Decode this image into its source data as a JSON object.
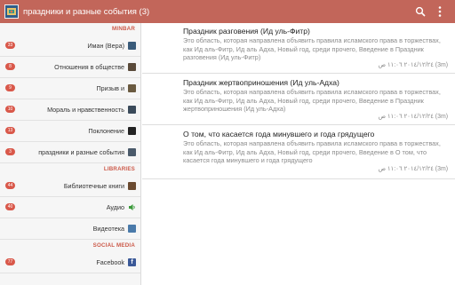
{
  "header": {
    "title": "праздники и разные события (3)",
    "search_icon": "search-icon",
    "menu_icon": "more-vertical-icon"
  },
  "sidebar": {
    "sections": [
      {
        "title": "MINBAR",
        "items": [
          {
            "label": "Иман (Вера)",
            "badge": "33",
            "icon": "book-icon",
            "icon_color": "#3a5b7a"
          },
          {
            "label": "Отношения в обществе",
            "badge": "8",
            "icon": "people-icon",
            "icon_color": "#5a4a3a"
          },
          {
            "label": "Призыв и",
            "badge": "9",
            "icon": "mosque-icon",
            "icon_color": "#6a5a40"
          },
          {
            "label": "Мораль и нравственность",
            "badge": "10",
            "icon": "flag-icon",
            "icon_color": "#3a4a5a"
          },
          {
            "label": "Поклонение",
            "badge": "13",
            "icon": "kaaba-icon",
            "icon_color": "#222222"
          },
          {
            "label": "праздники и разные события",
            "badge": "3",
            "icon": "celebration-icon",
            "icon_color": "#4a5a6a"
          }
        ]
      },
      {
        "title": "LIBRARIES",
        "items": [
          {
            "label": "Библиотечные книги",
            "badge": "44",
            "icon": "books-icon",
            "icon_color": "#6a4a30"
          },
          {
            "label": "Аудио",
            "badge": "40",
            "icon": "speaker-icon",
            "icon_color": "#3a9a3a"
          },
          {
            "label": "Видеотека",
            "badge": "",
            "icon": "video-icon",
            "icon_color": "#4a7aaa"
          }
        ]
      },
      {
        "title": "SOCIAL MEDIA",
        "items": [
          {
            "label": "Facebook",
            "badge": "77",
            "icon": "facebook-icon",
            "icon_color": "#3b5998"
          }
        ]
      }
    ]
  },
  "articles": [
    {
      "title": "Праздник разговения (Ид уль-Фитр)",
      "excerpt": "Это область, которая направлена объявить правила исламского права в торжествах, как Ид аль-Фитр, Ид аль Адха, Новый год, среди прочего, Введение в Праздник разговения (Ид уль-Фитр)",
      "date": "٢٠١٤/١٢/٢٤ ١١:٠٦ ص (3m)"
    },
    {
      "title": "Праздник жертвоприношения (Ид уль-Адха)",
      "excerpt": "Это область, которая направлена объявить правила исламского права в торжествах, как Ид аль-Фитр, Ид аль Адха, Новый год, среди прочего, Введение в Праздник жертвоприношения (Ид уль-Адха)",
      "date": "٢٠١٤/١٢/٢٤ ١١:٠٦ ص (3m)"
    },
    {
      "title": "О том, что касается года минувшего и года грядущего",
      "excerpt": "Это область, которая направлена объявить правила исламского права в торжествах, как Ид аль-Фитр, Ид аль Адха, Новый год, среди прочего, Введение в О том, что касается года минувшего и года грядущего",
      "date": "٢٠١٤/١٢/٢٤ ١١:٠٦ ص (3m)"
    }
  ]
}
